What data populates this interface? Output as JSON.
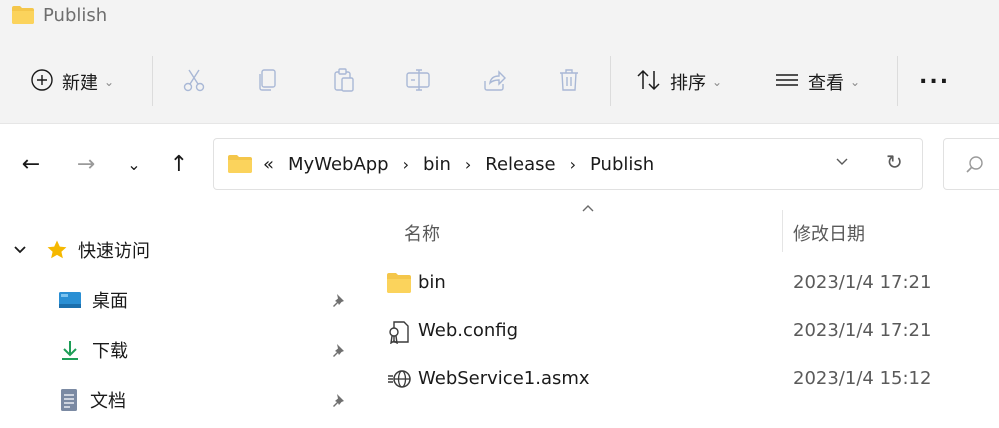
{
  "window": {
    "title": "Publish",
    "icon": "folder-icon"
  },
  "commandbar": {
    "new_label": "新建",
    "sort_label": "排序",
    "view_label": "查看",
    "more_label": "...",
    "icons": [
      "cut-icon",
      "copy-icon",
      "paste-icon",
      "rename-icon",
      "share-icon",
      "delete-icon"
    ]
  },
  "navigation": {
    "back": "←",
    "forward": "→",
    "recent": "⌄",
    "up": "↑",
    "breadcrumb_overflow": "«",
    "breadcrumb": [
      "MyWebApp",
      "bin",
      "Release",
      "Publish"
    ],
    "breadcrumb_separator": "›",
    "refresh": "↻"
  },
  "sidebar": {
    "quick_access_label": "快速访问",
    "items": [
      {
        "label": "桌面",
        "icon": "desktop-icon"
      },
      {
        "label": "下载",
        "icon": "download-icon"
      },
      {
        "label": "文档",
        "icon": "document-icon"
      }
    ]
  },
  "filelist": {
    "columns": {
      "name": "名称",
      "modified": "修改日期"
    },
    "files": [
      {
        "name": "bin",
        "modified": "2023/1/4 17:21",
        "icon": "folder-icon"
      },
      {
        "name": "Web.config",
        "modified": "2023/1/4 17:21",
        "icon": "config-file-icon"
      },
      {
        "name": "WebService1.asmx",
        "modified": "2023/1/4 15:12",
        "icon": "web-service-file-icon"
      }
    ]
  },
  "colors": {
    "folder_yellow": "#f4c64a",
    "star_yellow": "#f5b800",
    "download_green": "#1e9e57",
    "chrome_gray": "#f3f3f3"
  }
}
